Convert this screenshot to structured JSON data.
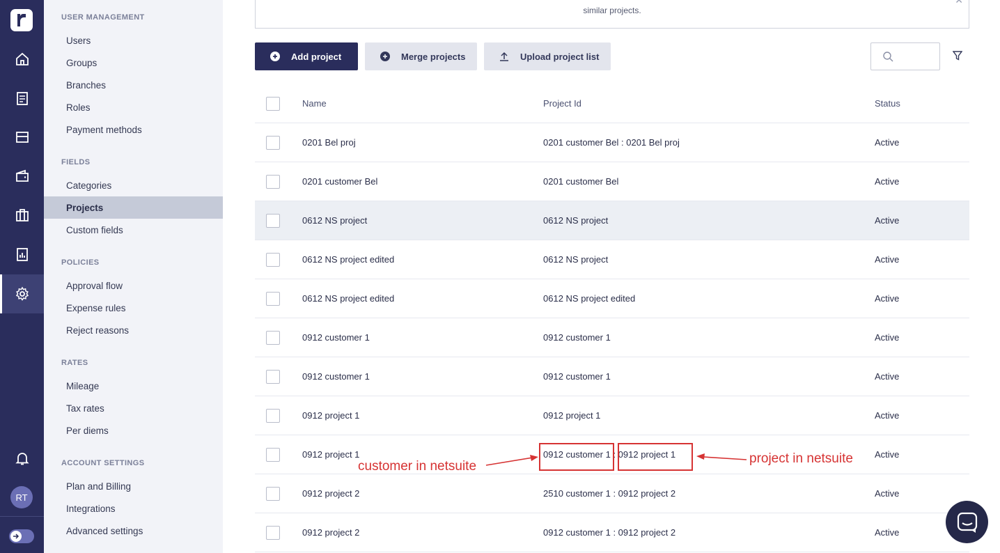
{
  "rail": {
    "avatar_initials": "RT",
    "icons": [
      "home-icon",
      "receipt-icon",
      "card-icon",
      "wallet-icon",
      "building-icon",
      "report-icon",
      "settings-icon"
    ]
  },
  "sidebar": {
    "user_management": {
      "title": "USER MANAGEMENT",
      "items": [
        "Users",
        "Groups",
        "Branches",
        "Roles",
        "Payment methods"
      ]
    },
    "fields": {
      "title": "FIELDS",
      "items": [
        "Categories",
        "Projects",
        "Custom fields"
      ],
      "active": "Projects"
    },
    "policies": {
      "title": "POLICIES",
      "items": [
        "Approval flow",
        "Expense rules",
        "Reject reasons"
      ]
    },
    "rates": {
      "title": "RATES",
      "items": [
        "Mileage",
        "Tax rates",
        "Per diems"
      ]
    },
    "account_settings": {
      "title": "ACCOUNT SETTINGS",
      "items": [
        "Plan and Billing",
        "Integrations",
        "Advanced settings"
      ]
    }
  },
  "info": {
    "text": "similar projects."
  },
  "toolbar": {
    "add_label": "Add project",
    "merge_label": "Merge projects",
    "upload_label": "Upload project list",
    "search_placeholder": ""
  },
  "table": {
    "headers": {
      "name": "Name",
      "project_id": "Project Id",
      "status": "Status"
    },
    "rows": [
      {
        "name": "0201 Bel proj",
        "project_id": "0201 customer Bel : 0201 Bel proj",
        "status": "Active"
      },
      {
        "name": "0201 customer Bel",
        "project_id": "0201 customer Bel",
        "status": "Active"
      },
      {
        "name": "0612 NS project",
        "project_id": "0612 NS project",
        "status": "Active"
      },
      {
        "name": "0612 NS project edited",
        "project_id": "0612 NS project",
        "status": "Active"
      },
      {
        "name": "0612 NS project edited",
        "project_id": "0612 NS project edited",
        "status": "Active"
      },
      {
        "name": "0912 customer 1",
        "project_id": "0912 customer 1",
        "status": "Active"
      },
      {
        "name": "0912 customer 1",
        "project_id": "0912 customer 1",
        "status": "Active"
      },
      {
        "name": "0912 project 1",
        "project_id": "0912 project 1",
        "status": "Active"
      },
      {
        "name": "0912 project 1",
        "project_id": "0912 customer 1 : 0912 project 1",
        "status": "Active"
      },
      {
        "name": "0912 project 2",
        "project_id": "2510 customer 1 : 0912 project 2",
        "status": "Active"
      },
      {
        "name": "0912 project 2",
        "project_id": "0912 customer 1 : 0912 project 2",
        "status": "Active"
      }
    ]
  },
  "annotations": {
    "left_label": "customer in netsuite",
    "right_label": "project in netsuite",
    "color": "#d63333"
  },
  "colors": {
    "rail": "#2a2d5c",
    "primary_button": "#2a2d5c",
    "sidebar_bg": "#f2f3f8",
    "active_item": "#c5cad8"
  }
}
